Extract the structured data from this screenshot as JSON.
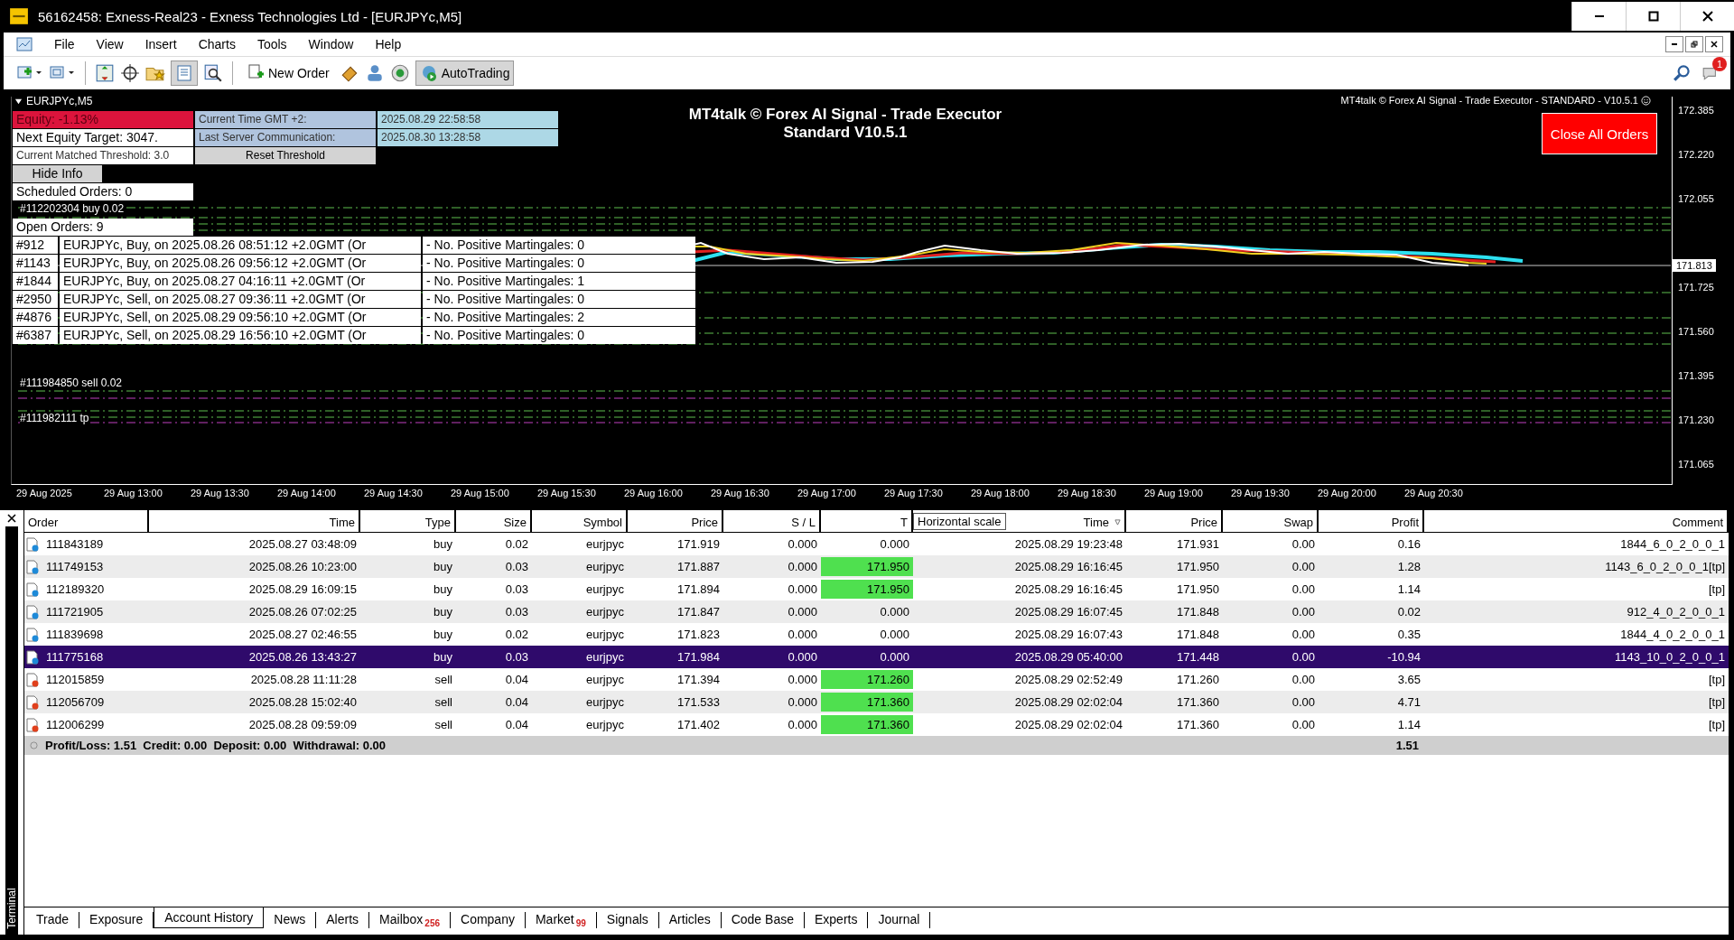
{
  "window": {
    "title": "56162458: Exness-Real23 - Exness Technologies Ltd - [EURJPYc,M5]"
  },
  "menu": [
    "File",
    "View",
    "Insert",
    "Charts",
    "Tools",
    "Window",
    "Help"
  ],
  "toolbar": {
    "new_order": "New Order",
    "autotrading": {
      "label": "AutoTrading",
      "on": true
    },
    "notification_count": "1"
  },
  "chart": {
    "symbol": "EURJPYc,M5",
    "title_lines": [
      "MT4talk © Forex AI Signal - Trade Executor",
      "Standard V10.5.1"
    ],
    "corner_note": "MT4talk © Forex AI Signal - Trade Executor - STANDARD - V10.5.1",
    "close_button": "Close All Orders",
    "info": {
      "equity": "Equity: -1.13%",
      "next_target": "Next Equity Target: 3047.",
      "current_time_label": "Current Time GMT +2:",
      "current_time": "2025.08.29 22:58:58",
      "server_label": "Last Server Communication:",
      "server_time": "2025.08.30 13:28:58",
      "threshold": "Current Matched Threshold: 3.0",
      "reset_button": "Reset Threshold",
      "hide_button": "Hide Info",
      "scheduled": "Scheduled Orders: 0",
      "open": "Open Orders: 9"
    },
    "open_orders": [
      {
        "id": "#912",
        "details": "EURJPYc, Buy, on 2025.08.26 08:51:12 +2.0GMT  (Or",
        "martingales": "- No. Positive Martingales: 0"
      },
      {
        "id": "#1143",
        "details": "EURJPYc, Buy, on 2025.08.26 09:56:12 +2.0GMT  (Or",
        "martingales": "- No. Positive Martingales: 0"
      },
      {
        "id": "#1844",
        "details": "EURJPYc, Buy, on 2025.08.27 04:16:11 +2.0GMT  (Or",
        "martingales": "- No. Positive Martingales: 1"
      },
      {
        "id": "#2950",
        "details": "EURJPYc, Sell, on 2025.08.27 09:36:11 +2.0GMT  (Or",
        "martingales": "- No. Positive Martingales: 0"
      },
      {
        "id": "#4876",
        "details": "EURJPYc, Sell, on 2025.08.29 09:56:10 +2.0GMT  (Or",
        "martingales": "- No. Positive Martingales: 2"
      },
      {
        "id": "#6387",
        "details": "EURJPYc, Sell, on 2025.08.29 16:56:10 +2.0GMT  (Or",
        "martingales": "- No. Positive Martingales: 0"
      }
    ],
    "order_labels": [
      "#112202304 buy 0.02",
      "#111984850 sell 0.02",
      "#111982111 tp"
    ],
    "price_axis": [
      "172.385",
      "172.220",
      "172.055",
      "171.725",
      "171.560",
      "171.395",
      "171.230",
      "171.065"
    ],
    "current_price": "171.813",
    "time_axis": [
      "29 Aug 2025",
      "29 Aug 13:00",
      "29 Aug 13:30",
      "29 Aug 14:00",
      "29 Aug 14:30",
      "29 Aug 15:00",
      "29 Aug 15:30",
      "29 Aug 16:00",
      "29 Aug 16:30",
      "29 Aug 17:00",
      "29 Aug 17:30",
      "29 Aug 18:00",
      "29 Aug 18:30",
      "29 Aug 19:00",
      "29 Aug 19:30",
      "29 Aug 20:00",
      "29 Aug 20:30"
    ]
  },
  "terminal": {
    "label": "Terminal",
    "tooltip": "Horizontal scale",
    "columns": [
      "Order",
      "Time",
      "Type",
      "Size",
      "Symbol",
      "Price",
      "S / L",
      "T",
      "Time",
      "Price",
      "Swap",
      "Profit",
      "Comment"
    ],
    "rows": [
      {
        "kind": "buy",
        "selected": false,
        "tp_hit": false,
        "cells": [
          "111843189",
          "2025.08.27 03:48:09",
          "buy",
          "0.02",
          "eurjpyc",
          "171.919",
          "0.000",
          "0.000",
          "2025.08.29 19:23:48",
          "171.931",
          "0.00",
          "0.16",
          "1844_6_0_2_0_0_1"
        ]
      },
      {
        "kind": "buy",
        "selected": false,
        "tp_hit": true,
        "cells": [
          "111749153",
          "2025.08.26 10:23:00",
          "buy",
          "0.03",
          "eurjpyc",
          "171.887",
          "0.000",
          "171.950",
          "2025.08.29 16:16:45",
          "171.950",
          "0.00",
          "1.28",
          "1143_6_0_2_0_0_1[tp]"
        ]
      },
      {
        "kind": "buy",
        "selected": false,
        "tp_hit": true,
        "cells": [
          "112189320",
          "2025.08.29 16:09:15",
          "buy",
          "0.03",
          "eurjpyc",
          "171.894",
          "0.000",
          "171.950",
          "2025.08.29 16:16:45",
          "171.950",
          "0.00",
          "1.14",
          "[tp]"
        ]
      },
      {
        "kind": "buy",
        "selected": false,
        "tp_hit": false,
        "cells": [
          "111721905",
          "2025.08.26 07:02:25",
          "buy",
          "0.03",
          "eurjpyc",
          "171.847",
          "0.000",
          "0.000",
          "2025.08.29 16:07:45",
          "171.848",
          "0.00",
          "0.02",
          "912_4_0_2_0_0_1"
        ]
      },
      {
        "kind": "buy",
        "selected": false,
        "tp_hit": false,
        "cells": [
          "111839698",
          "2025.08.27 02:46:55",
          "buy",
          "0.02",
          "eurjpyc",
          "171.823",
          "0.000",
          "0.000",
          "2025.08.29 16:07:43",
          "171.848",
          "0.00",
          "0.35",
          "1844_4_0_2_0_0_1"
        ]
      },
      {
        "kind": "buy",
        "selected": true,
        "tp_hit": false,
        "cells": [
          "111775168",
          "2025.08.26 13:43:27",
          "buy",
          "0.03",
          "eurjpyc",
          "171.984",
          "0.000",
          "0.000",
          "2025.08.29 05:40:00",
          "171.448",
          "0.00",
          "-10.94",
          "1143_10_0_2_0_0_1"
        ]
      },
      {
        "kind": "sell",
        "selected": false,
        "tp_hit": true,
        "cells": [
          "112015859",
          "2025.08.28 11:11:28",
          "sell",
          "0.04",
          "eurjpyc",
          "171.394",
          "0.000",
          "171.260",
          "2025.08.29 02:52:49",
          "171.260",
          "0.00",
          "3.65",
          "[tp]"
        ]
      },
      {
        "kind": "sell",
        "selected": false,
        "tp_hit": true,
        "cells": [
          "112056709",
          "2025.08.28 15:02:40",
          "sell",
          "0.04",
          "eurjpyc",
          "171.533",
          "0.000",
          "171.360",
          "2025.08.29 02:02:04",
          "171.360",
          "0.00",
          "4.71",
          "[tp]"
        ]
      },
      {
        "kind": "sell",
        "selected": false,
        "tp_hit": true,
        "cells": [
          "112006299",
          "2025.08.28 09:59:09",
          "sell",
          "0.04",
          "eurjpyc",
          "171.402",
          "0.000",
          "171.360",
          "2025.08.29 02:02:04",
          "171.360",
          "0.00",
          "1.14",
          "[tp]"
        ]
      }
    ],
    "summary": {
      "text": "Profit/Loss: 1.51  Credit: 0.00  Deposit: 0.00  Withdrawal: 0.00",
      "profit": "1.51"
    },
    "tabs": [
      {
        "label": "Trade",
        "selected": false
      },
      {
        "label": "Exposure",
        "selected": false
      },
      {
        "label": "Account History",
        "selected": true
      },
      {
        "label": "News",
        "selected": false
      },
      {
        "label": "Alerts",
        "selected": false
      },
      {
        "label": "Mailbox",
        "badge": "256",
        "selected": false
      },
      {
        "label": "Company",
        "selected": false
      },
      {
        "label": "Market",
        "badge": "99",
        "selected": false
      },
      {
        "label": "Signals",
        "selected": false
      },
      {
        "label": "Articles",
        "selected": false
      },
      {
        "label": "Code Base",
        "selected": false
      },
      {
        "label": "Experts",
        "selected": false
      },
      {
        "label": "Journal",
        "selected": false
      }
    ]
  }
}
